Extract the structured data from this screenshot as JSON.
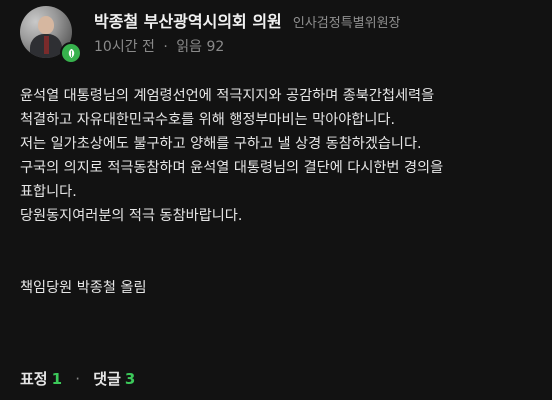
{
  "author": {
    "name": "박종철 부산광역시의회 의원",
    "title": "인사검정특별위원장",
    "badge_icon": "leaf-icon"
  },
  "meta": {
    "time": "10시간 전",
    "separator": "·",
    "views": "읽음 92"
  },
  "body": {
    "lines": [
      "윤석열 대통령님의 계엄령선언에 적극지지와 공감하며 종북간첩세력을",
      "척결하고 자유대한민국수호를 위해 행정부마비는 막아야합니다.",
      "저는 일가초상에도 불구하고 양해를 구하고 낼 상경 동참하겠습니다.",
      "구국의 의지로 적극동참하며 윤석열 대통령님의 결단에 다시한번 경의을",
      "표합니다.",
      "당원동지여러분의 적극 동참바랍니다."
    ],
    "signature": "책임당원 박종철 올림"
  },
  "footer": {
    "reactions_label": "표정",
    "reactions_count": "1",
    "separator": "·",
    "comments_label": "댓글",
    "comments_count": "3"
  },
  "colors": {
    "background": "#121212",
    "accent_green": "#3cc95a",
    "badge_green": "#37b24d",
    "muted": "#8a8a8a"
  }
}
